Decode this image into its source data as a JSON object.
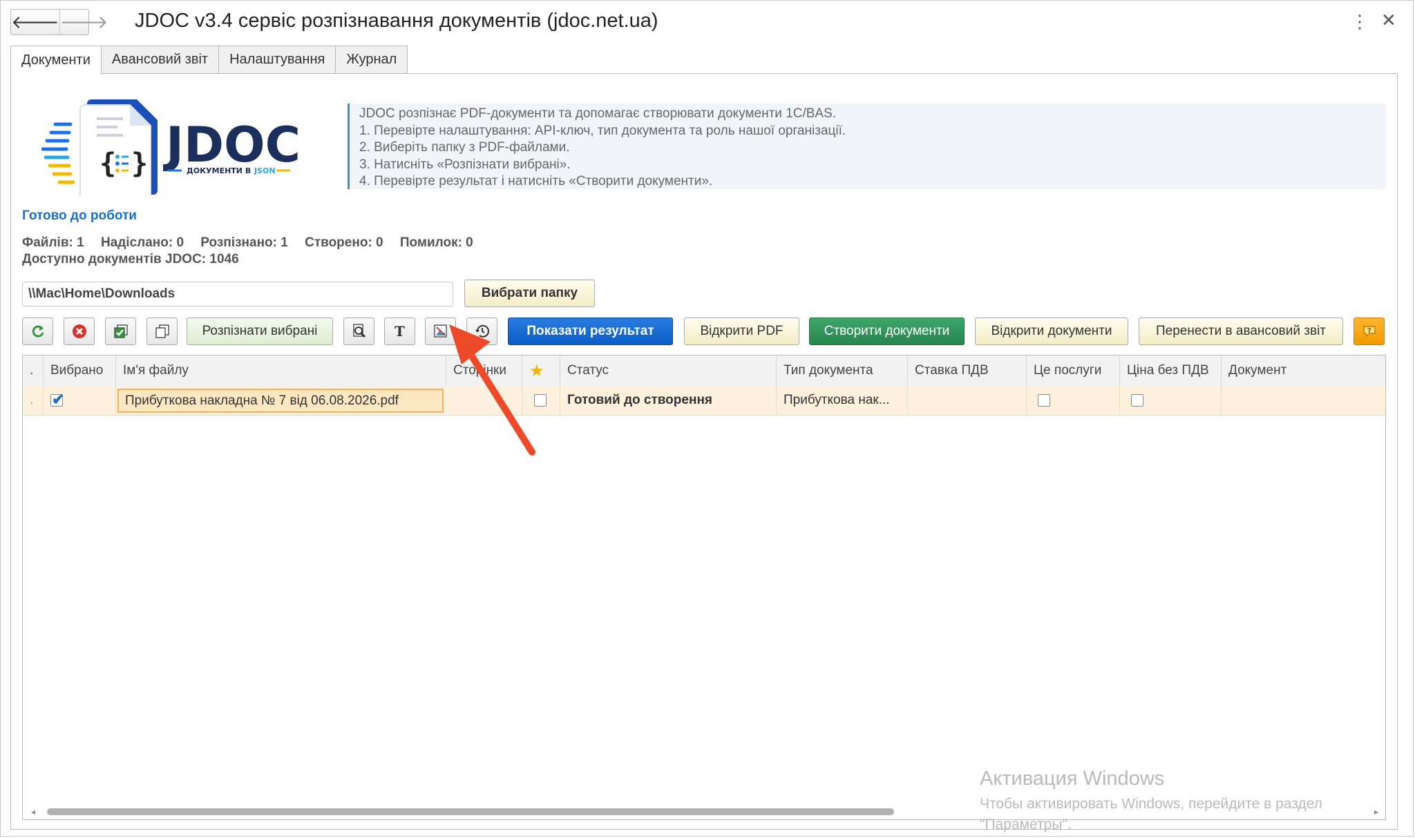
{
  "window": {
    "title": "JDOC v3.4 сервіс розпізнавання документів (jdoc.net.ua)",
    "back_glyph": "🡐",
    "forward_glyph": "🡒",
    "menu_glyph": "⋮",
    "close_glyph": "✕"
  },
  "tabs": [
    {
      "label": "Документи",
      "active": true
    },
    {
      "label": "Авансовий звіт",
      "active": false
    },
    {
      "label": "Налаштування",
      "active": false
    },
    {
      "label": "Журнал",
      "active": false
    }
  ],
  "logo": {
    "brand": "JDOC",
    "tagline_prefix": "ДОКУМЕНТИ В",
    "tagline_suffix": "JSON"
  },
  "info": {
    "lines": [
      "JDOC розпізнає PDF-документи та допомагає створювати документи 1С/BAS.",
      "1. Перевірте налаштування: API-ключ, тип документа та роль нашої організації.",
      "2. Виберіть папку з PDF-файлами.",
      "3. Натисніть «Розпізнати вибрані».",
      "4. Перевірте результат і натисніть «Створити документи»."
    ]
  },
  "status": {
    "text": "Готово до роботи",
    "files": "Файлів: 1",
    "sent": "Надіслано: 0",
    "recognized": "Розпізнано: 1",
    "created": "Створено: 0",
    "errors": "Помилок: 0",
    "available": "Доступно документів JDOC: 1046"
  },
  "folder": {
    "path": "\\\\Mac\\Home\\Downloads",
    "choose_label": "Вибрати папку"
  },
  "toolbar": {
    "recognize_label": "Розпізнати вибрані",
    "text_icon_glyph": "T",
    "show_result_label": "Показати результат",
    "open_pdf_label": "Відкрити PDF",
    "create_docs_label": "Створити документи",
    "open_docs_label": "Відкрити документи",
    "transfer_label": "Перенести в авансовий звіт"
  },
  "table": {
    "columns": [
      "",
      "Вибрано",
      "Ім'я файлу",
      "Сторінки",
      "★",
      "Статус",
      "Тип документа",
      "Ставка ПДВ",
      "Це послуги",
      "Ціна без ПДВ",
      "Документ"
    ],
    "rows": [
      {
        "marker": ".",
        "selected": true,
        "file_name": "Прибуткова накладна № 7 від 06.08.2026.pdf",
        "pages": "",
        "starred": false,
        "status": "Готовий до створення",
        "doc_type": "Прибуткова нак...",
        "vat_rate": "",
        "is_services": false,
        "price_no_vat": false,
        "document": ""
      }
    ]
  },
  "watermark": {
    "line1": "Активация Windows",
    "line2": "Чтобы активировать Windows, перейдите в раздел",
    "line3": "\"Параметры\"."
  },
  "colors": {
    "accent_blue": "#0b5ec6",
    "green": "#27864e",
    "orange": "#f29a00",
    "row_highlight": "#fdf0dc",
    "annotation_arrow": "#ee4a2a"
  }
}
